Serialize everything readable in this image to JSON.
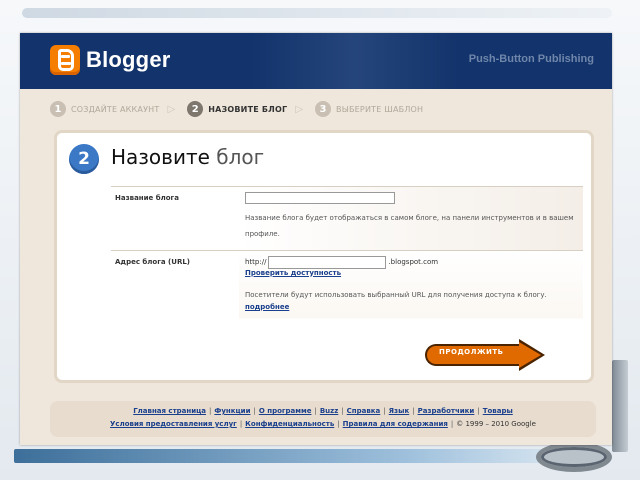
{
  "header": {
    "brand": "Blogger",
    "tagline": "Push-Button Publishing"
  },
  "steps": [
    {
      "num": "1",
      "label": "СОЗДАЙТЕ АККАУНТ",
      "active": false
    },
    {
      "num": "2",
      "label": "НАЗОВИТЕ БЛОГ",
      "active": true
    },
    {
      "num": "3",
      "label": "ВЫБЕРИТЕ ШАБЛОН",
      "active": false
    }
  ],
  "card": {
    "step_number": "2",
    "title_main": "Назовите",
    "title_sub": "блог"
  },
  "form": {
    "blog_name": {
      "label": "Название блога",
      "value": "",
      "hint": "Название блога будет отображаться в самом блоге, на панели инструментов и в вашем профиле."
    },
    "blog_address": {
      "label": "Адрес блога (URL)",
      "prefix": "http://",
      "value": "",
      "suffix": ".blogspot.com",
      "check_link": "Проверить доступность",
      "hint": "Посетители будут использовать выбранный URL для получения доступа к блогу.",
      "more_link": "подробнее"
    }
  },
  "continue_label": "ПРОДОЛЖИТЬ",
  "footer": {
    "row1": [
      "Главная страница",
      "Функции",
      "О программе",
      "Buzz",
      "Справка",
      "Язык",
      "Разработчики",
      "Товары"
    ],
    "row2": [
      "Условия предоставления услуг",
      "Конфиденциальность",
      "Правила для содержания"
    ],
    "copyright": "© 1999 – 2010 Google"
  },
  "colors": {
    "header_bg": "#12336b",
    "accent_orange": "#e06a00",
    "step_blue": "#3b78c6",
    "link": "#1a3f8c"
  }
}
